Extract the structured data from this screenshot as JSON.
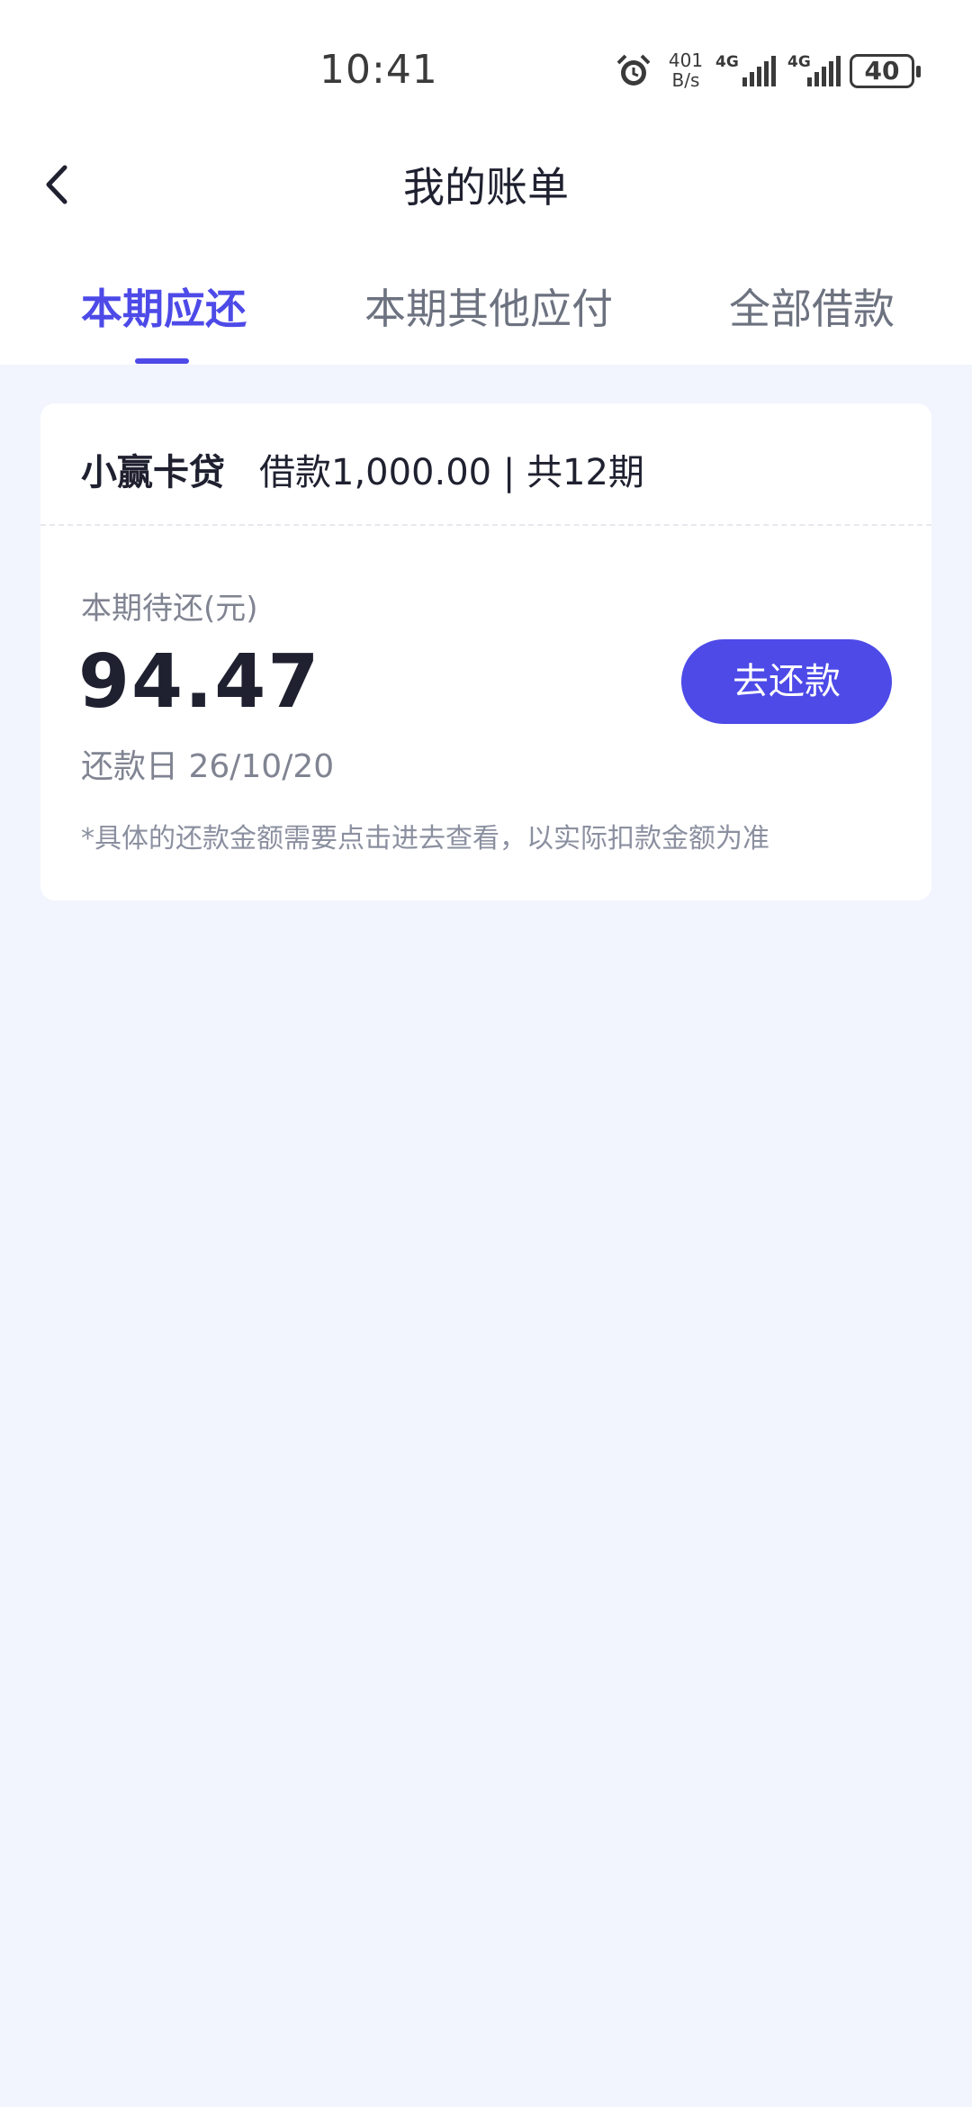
{
  "status_bar": {
    "time": "10:41",
    "net_speed_value": "401",
    "net_speed_unit": "B/s",
    "signal1_label": "4G",
    "signal2_label": "4G",
    "battery": "40"
  },
  "header": {
    "title": "我的账单"
  },
  "tabs": [
    {
      "label": "本期应还",
      "active": true
    },
    {
      "label": "本期其他应付",
      "active": false
    },
    {
      "label": "全部借款",
      "active": false
    }
  ],
  "bill_card": {
    "product_name": "小赢卡贷",
    "loan_info": "借款1,000.00 | 共12期",
    "due_label": "本期待还(元)",
    "amount": "94.47",
    "repay_button": "去还款",
    "due_date": "还款日 26/10/20",
    "note": "*具体的还款金额需要点击进去查看，以实际扣款金额为准"
  },
  "colors": {
    "accent": "#4d4ae8",
    "background": "#f2f5fd",
    "text_primary": "#1f2130",
    "text_secondary": "#808492"
  },
  "icons": [
    "alarm-icon",
    "signal-icon",
    "battery-icon",
    "back-arrow-icon"
  ]
}
